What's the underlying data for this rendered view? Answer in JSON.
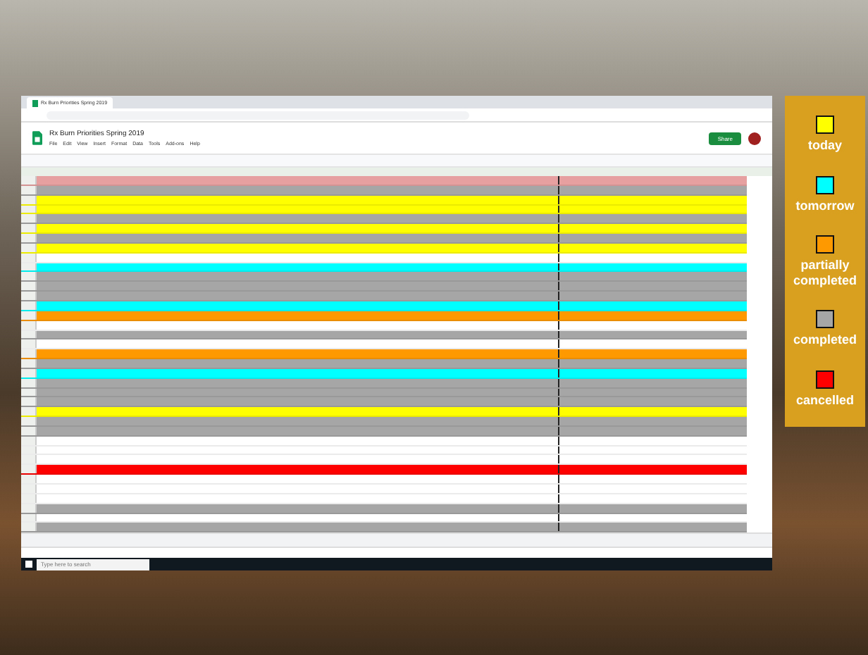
{
  "browser_tab": {
    "title": "Rx Burn Priorities Spring 2019"
  },
  "document": {
    "title": "Rx Burn Priorities Spring 2019",
    "menu": [
      "File",
      "Edit",
      "View",
      "Insert",
      "Format",
      "Data",
      "Tools",
      "Add-ons",
      "Help"
    ],
    "share_button": "Share"
  },
  "sheet": {
    "rows": [
      {
        "color": "#a6a6a6"
      },
      {
        "color": "#ffff00"
      },
      {
        "color": "#ffff00"
      },
      {
        "color": "#a6a6a6"
      },
      {
        "color": "#ffff00"
      },
      {
        "color": "#a6a6a6"
      },
      {
        "color": "#ffff00"
      },
      {
        "color": "#ffffff"
      },
      {
        "color": "#00ffff"
      },
      {
        "color": "#a6a6a6"
      },
      {
        "color": "#a6a6a6"
      },
      {
        "color": "#a6a6a6"
      },
      {
        "color": "#00ffff"
      },
      {
        "color": "#ff9900"
      },
      {
        "color": "#ffffff"
      },
      {
        "color": "#a6a6a6"
      },
      {
        "color": "#ffffff"
      },
      {
        "color": "#ff9900"
      },
      {
        "color": "#a6a6a6"
      },
      {
        "color": "#00ffff"
      },
      {
        "color": "#a6a6a6"
      },
      {
        "color": "#a6a6a6"
      },
      {
        "color": "#a6a6a6"
      },
      {
        "color": "#ffff00"
      },
      {
        "color": "#a6a6a6"
      },
      {
        "color": "#a6a6a6"
      },
      {
        "color": "#ffffff"
      },
      {
        "color": "#ffffff"
      },
      {
        "color": "#ffffff"
      },
      {
        "color": "#ff0000"
      },
      {
        "color": "#ffffff"
      },
      {
        "color": "#ffffff"
      },
      {
        "color": "#ffffff"
      },
      {
        "color": "#a6a6a6"
      },
      {
        "color": "#ffffff"
      },
      {
        "color": "#a6a6a6"
      }
    ]
  },
  "taskbar": {
    "search": {
      "placeholder": "Type here to search"
    }
  },
  "legend": {
    "items": [
      {
        "label": "today",
        "color": "#ffff00"
      },
      {
        "label": "tomorrow",
        "color": "#00ffff"
      },
      {
        "label": "partially completed",
        "color": "#ff9900"
      },
      {
        "label": "completed",
        "color": "#a6a6a6"
      },
      {
        "label": "cancelled",
        "color": "#ff0000"
      }
    ]
  }
}
